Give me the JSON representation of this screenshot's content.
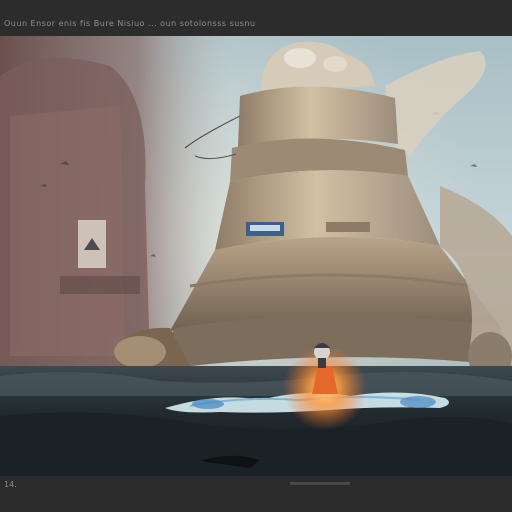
{
  "header": {
    "caption": "Ouun Ensor enis fis Bure Nisiuo ... oun sotolonsss susnu"
  },
  "image": {
    "subject": "sci-fi vessel rising from a stormy sea with a small figure in orange near the wave crest",
    "palette": {
      "sky": "#b9cdd4",
      "haze": "#7a6a66",
      "hull": "#c6b49a",
      "sea_dark": "#1c2428",
      "foam": "#d7eef5",
      "glow": "#ff9a3a",
      "figure": "#e5672a"
    }
  },
  "footer": {
    "mark": "14."
  }
}
